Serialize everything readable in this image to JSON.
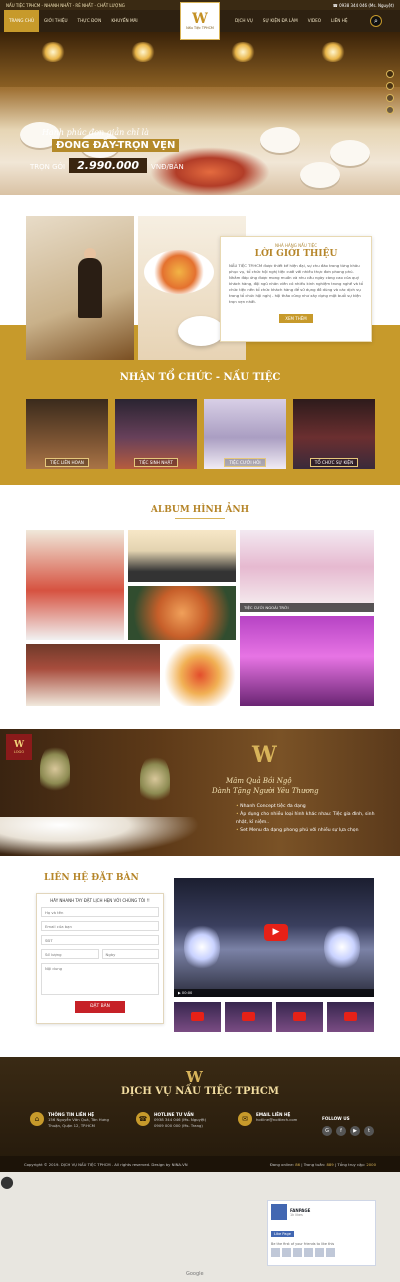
{
  "topbar": {
    "slogan": "NẤU TIỆC TPHCM - NHANH NHẤT - RẺ NHẤT - CHẤT LƯỢNG",
    "hotline": "0938 344 046 (Ms. Nguyệt)"
  },
  "nav": {
    "left": [
      "TRANG CHỦ",
      "GIỚI THIỆU",
      "THỰC ĐƠN",
      "KHUYẾN MÃI"
    ],
    "right": [
      "DỊCH VỤ",
      "SỰ KIỆN ĐÃ LÀM",
      "VIDEO",
      "LIÊN HỆ"
    ],
    "logo_text": "Nấu Tiệc TPHCM"
  },
  "hero": {
    "line1": "Hạnh phúc đơn giản chỉ là",
    "line2": "ĐONG ĐẦY-TRỌN VẸN",
    "price_label": "TRỌN GÓI",
    "price": "2.990.000",
    "unit": "VNĐ/BÀN"
  },
  "intro": {
    "subtitle": "NHÀ HÀNG NẤU TIỆC",
    "title": "LỜI GIỚI THIỆU",
    "body": "NẤU TIỆC TP.HCM được thiết kế hiện đại, sự chu đáo trong từng khâu phục vụ, tổ chức hội nghị tiệc cưới với nhiều thực đơn phong phú. Nhằm đáp ứng được mong muốn và nhu cầu ngày càng cao của quý khách hàng, đội ngũ nhân viên có nhiều kinh nghiệm trong nghề và tổ chức tiệc nên tổ chức khách hàng để sử dụng đồ dùng và các dịch vụ trong tổ chức hội nghị - hội thảo cũng như xây dựng một buổi sự kiện trọn vẹn nhất.",
    "button": "XEM THÊM"
  },
  "services": {
    "title": "NHẬN TỔ CHỨC - NẤU TIỆC",
    "items": [
      "TIỆC LIÊN HOAN",
      "TIỆC SINH NHẬT",
      "TIỆC CƯỚI HỎI",
      "TỔ CHỨC SỰ KIỆN"
    ]
  },
  "album": {
    "title": "ALBUM HÌNH ẢNH",
    "caption": "TIỆC CƯỚI NGOÀI TRỜI"
  },
  "banner": {
    "logo": "LOGO",
    "slogan1": "Mâm Quả Bồi Ngộ",
    "slogan2": "Dành Tặng Người Yêu Thương",
    "bullets": [
      "Nhanh Concept tiệc đa dạng",
      "Áp dụng cho nhiều loại hình khác nhau: Tiệc gia đình, sinh nhật, kỉ niệm..",
      "Set Menu đa dạng phong phú với nhiều sự lựa chọn"
    ]
  },
  "contact": {
    "title": "LIÊN HỆ ĐẶT BÀN",
    "form_heading": "HÃY NHANH TAY ĐẶT LỊCH HẸN VỚI CHÚNG TÔI !!",
    "name": "Họ và tên",
    "email": "Email của bạn",
    "phone": "SĐT",
    "hour": "Số lượng",
    "date": "Ngày",
    "content": "Nội dung",
    "button": "ĐẶT BÀN",
    "video_time": "00:00"
  },
  "footer": {
    "title": "DỊCH VỤ NẤU TIỆC TPHCM",
    "cols": [
      {
        "title": "THÔNG TIN LIÊN HỆ",
        "lines": [
          "156 Nguyễn Văn Quá, Tân Hưng",
          "Thuận, Quận 12, TP.HCM"
        ]
      },
      {
        "title": "HOTLINE TƯ VẤN",
        "lines": [
          "0938 344 046 (Ms. Nguyệt)",
          "0909 000 000 (Ms. Trang)"
        ]
      },
      {
        "title": "EMAIL LIÊN HỆ",
        "lines": [
          "hotline@noitiech.com"
        ]
      }
    ],
    "follow": "FOLLOW US",
    "copyright": "Copyright © 2019. DỊCH VỤ NẤU TIỆC TPHCM . All rights reserved. Design by NINA.VN",
    "online_label": "Đang online",
    "online": "86",
    "week_label": "Trong tuần",
    "week": "889",
    "total_label": "Tổng truy cập",
    "total": "2000"
  },
  "fb": {
    "name": "FANPAGE",
    "likes": "1k likes",
    "like_btn": "Like Page",
    "friends": "Be the first of your friends to like this"
  },
  "map": {
    "google": "Google"
  }
}
